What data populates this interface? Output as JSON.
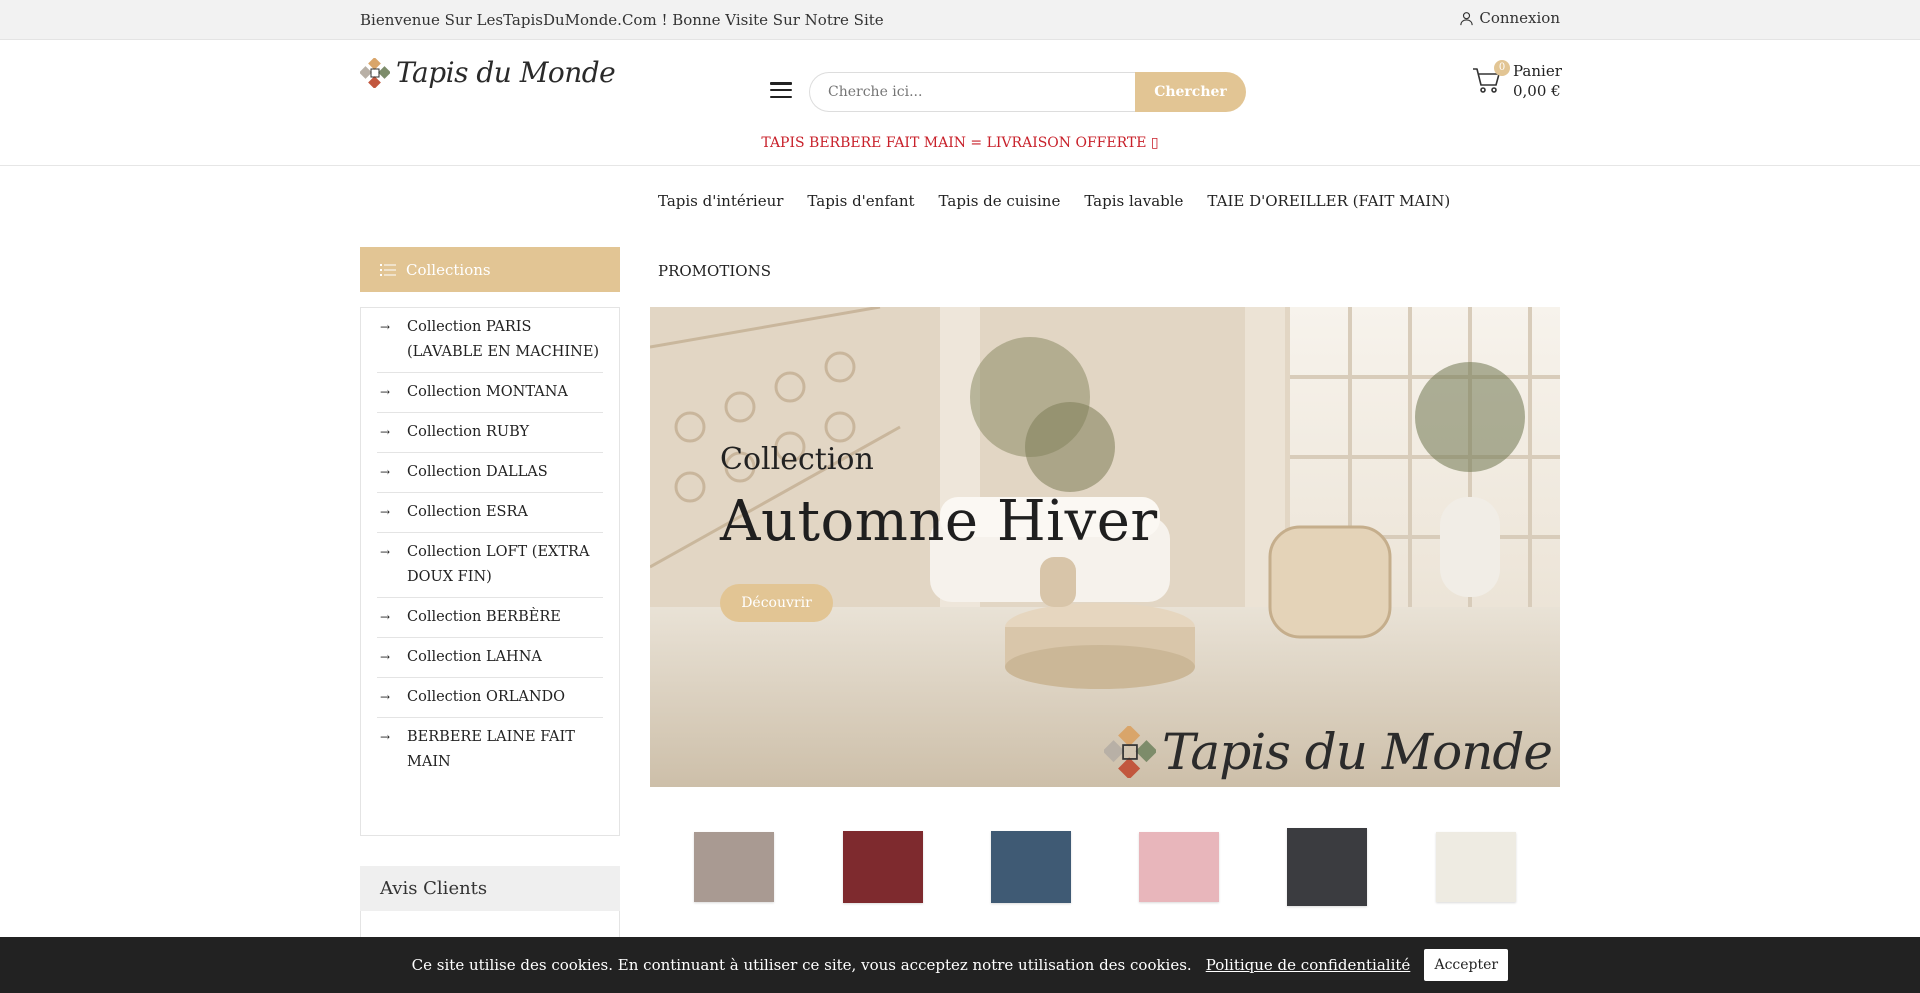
{
  "topbar": {
    "welcome": "Bienvenue Sur LesTapisDuMonde.Com ! Bonne Visite Sur Notre Site",
    "login_label": "Connexion"
  },
  "header": {
    "logo_text": "Tapis du Monde",
    "search": {
      "placeholder": "Cherche ici...",
      "button_label": "Chercher"
    },
    "cart": {
      "count": "0",
      "label": "Panier",
      "amount": "0,00 €"
    },
    "promo_banner": "TAPIS BERBERE FAIT MAIN = LIVRAISON OFFERTE ▯"
  },
  "nav": {
    "items": [
      "Tapis d'intérieur",
      "Tapis d'enfant",
      "Tapis de cuisine",
      "Tapis lavable",
      "TAIE D'OREILLER (FAIT MAIN)",
      "PROMOTIONS"
    ]
  },
  "sidebar": {
    "collections_title": "Collections",
    "items": [
      "Collection PARIS (LAVABLE EN MACHINE)",
      "Collection MONTANA",
      "Collection RUBY",
      "Collection DALLAS",
      "Collection ESRA",
      "Collection LOFT (EXTRA DOUX FIN)",
      "Collection BERBÈRE",
      "Collection LAHNA",
      "Collection ORLANDO",
      "BERBERE LAINE FAIT MAIN"
    ],
    "reviews_title": "Avis Clients"
  },
  "hero": {
    "subtitle": "Collection",
    "title": "Automne Hiver",
    "cta_label": "Découvrir",
    "brand_text": "Tapis du Monde"
  },
  "swatches": {
    "colors": [
      "#a99a92",
      "#7e2a2e",
      "#3f5a74",
      "#e8b6bb",
      "#3b3c40",
      "#eeebe2"
    ]
  },
  "cookie": {
    "message": "Ce site utilise des cookies. En continuant à utiliser ce site, vous acceptez notre utilisation des cookies.",
    "policy_link": "Politique de confidentialité",
    "accept_label": "Accepter"
  },
  "theme": {
    "accent": "#e2c594",
    "promo_red": "#c8202a",
    "cookie_bg": "#222222"
  }
}
